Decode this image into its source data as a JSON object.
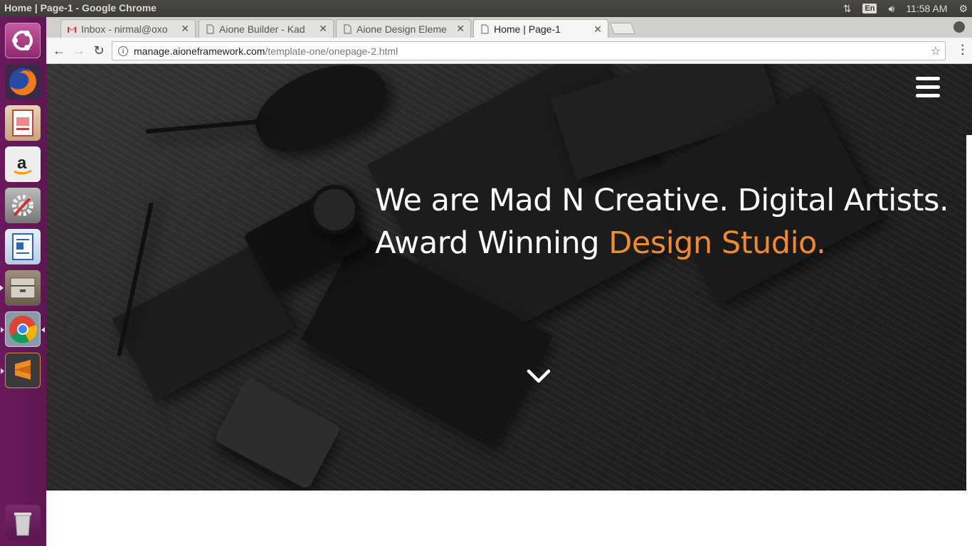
{
  "os": {
    "window_title": "Home | Page-1 - Google Chrome",
    "keyboard_lang": "En",
    "clock": "11:58 AM"
  },
  "launcher": {
    "items": [
      {
        "name": "ubuntu-dash",
        "color": "#b5468f"
      },
      {
        "name": "firefox",
        "color": "#e66000"
      },
      {
        "name": "impress",
        "color": "#c44e1f"
      },
      {
        "name": "amazon",
        "color": "#f0f0f0"
      },
      {
        "name": "system-settings",
        "color": "#8a8a8a"
      },
      {
        "name": "writer",
        "color": "#2a6ab3"
      },
      {
        "name": "files",
        "color": "#8c7a6b"
      },
      {
        "name": "chrome",
        "color": "#4285f4"
      },
      {
        "name": "sublime-text",
        "color": "#f08a24"
      },
      {
        "name": "trash",
        "color": "#cfcfcf"
      }
    ]
  },
  "browser": {
    "tabs": [
      {
        "label": "Inbox - nirmal@oxo",
        "icon": "gmail-icon"
      },
      {
        "label": "Aione Builder - Kad",
        "icon": "page-icon"
      },
      {
        "label": "Aione Design Eleme",
        "icon": "page-icon"
      },
      {
        "label": "Home | Page-1",
        "icon": "page-icon",
        "active": true
      }
    ],
    "url_host": "manage.aioneframework.com",
    "url_path": "/template-one/onepage-2.html"
  },
  "page": {
    "headline_line1": "We are Mad N Creative. Digital Artists.",
    "headline_line2_plain": "Award Winning ",
    "headline_line2_accent": "Design Studio.",
    "accent_color": "#f18a2e"
  }
}
